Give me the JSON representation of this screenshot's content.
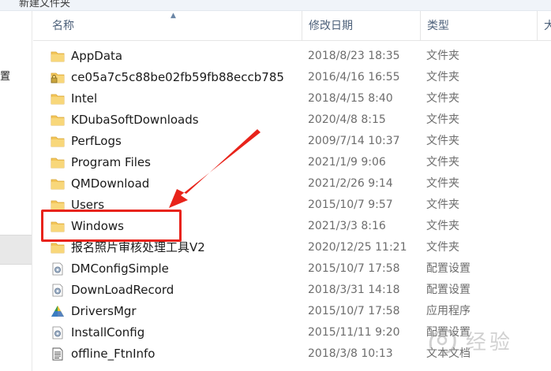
{
  "window": {
    "title": "新建文件夹"
  },
  "navpane": {
    "partial_label": "置"
  },
  "columns": {
    "name": "名称",
    "date": "修改日期",
    "type": "类型",
    "size": "大"
  },
  "files": [
    {
      "name": "AppData",
      "date": "2018/8/23 18:35",
      "type": "文件夹",
      "icon": "folder-icon"
    },
    {
      "name": "ce05a7c5c88be02fb59fb88eccb785",
      "date": "2016/4/16 16:55",
      "type": "文件夹",
      "icon": "locked-folder-icon"
    },
    {
      "name": "Intel",
      "date": "2018/4/15 8:40",
      "type": "文件夹",
      "icon": "folder-icon"
    },
    {
      "name": "KDubaSoftDownloads",
      "date": "2020/4/8 8:15",
      "type": "文件夹",
      "icon": "folder-icon"
    },
    {
      "name": "PerfLogs",
      "date": "2009/7/14 10:37",
      "type": "文件夹",
      "icon": "folder-icon"
    },
    {
      "name": "Program Files",
      "date": "2021/1/9 9:06",
      "type": "文件夹",
      "icon": "folder-icon"
    },
    {
      "name": "QMDownload",
      "date": "2021/2/26 9:14",
      "type": "文件夹",
      "icon": "folder-icon"
    },
    {
      "name": "Users",
      "date": "2015/10/7 9:57",
      "type": "文件夹",
      "icon": "folder-icon"
    },
    {
      "name": "Windows",
      "date": "2021/3/3 8:16",
      "type": "文件夹",
      "icon": "folder-icon"
    },
    {
      "name": "报名照片审核处理工具V2",
      "date": "2020/12/25 11:21",
      "type": "文件夹",
      "icon": "folder-icon"
    },
    {
      "name": "DMConfigSimple",
      "date": "2015/10/7 17:58",
      "type": "配置设置",
      "icon": "config-file-icon"
    },
    {
      "name": "DownLoadRecord",
      "date": "2018/3/31 14:18",
      "type": "配置设置",
      "icon": "config-file-icon"
    },
    {
      "name": "DriversMgr",
      "date": "2015/10/7 17:58",
      "type": "应用程序",
      "icon": "drivers-app-icon"
    },
    {
      "name": "InstallConfig",
      "date": "2015/11/11 9:20",
      "type": "配置设置",
      "icon": "config-file-icon"
    },
    {
      "name": "offline_FtnInfo",
      "date": "2018/3/8 10:13",
      "type": "文本文档",
      "icon": "text-file-icon"
    }
  ],
  "watermark": {
    "text": "经验"
  },
  "colors": {
    "annotation": "#e8231a",
    "folder": "#f3c65a",
    "header_text": "#4c607a",
    "meta_text": "#6d6d6d"
  }
}
